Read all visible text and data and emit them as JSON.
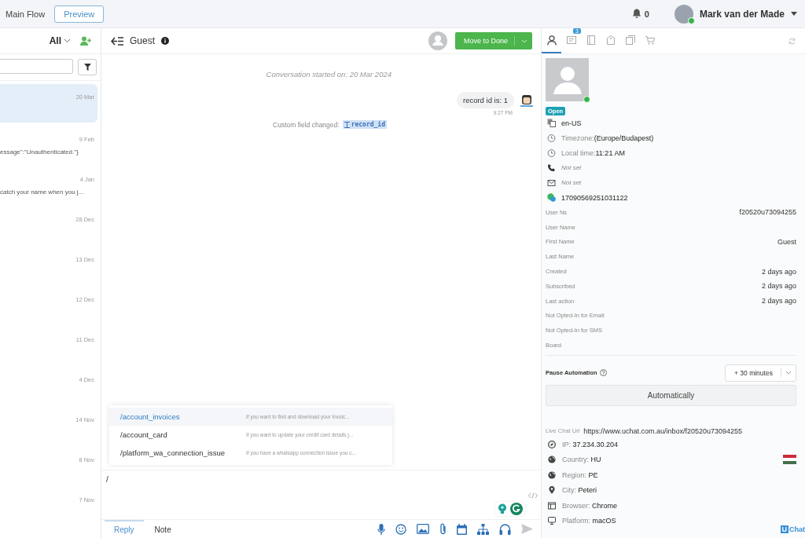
{
  "topbar": {
    "flow_name": "Main Flow",
    "preview_button": "Preview",
    "notifications": "0",
    "user_name": "Mark van der Made",
    "user_online": true
  },
  "conversation_list": {
    "filter": "All",
    "items": [
      {
        "date": "20 Mar",
        "selected": true
      },
      {
        "date": "9 Feb",
        "preview": "essage\":\"Unauthenticated.\"}",
        "selected": false
      },
      {
        "date": "4 Jan",
        "preview": "catch your name when you j...",
        "selected": false
      },
      {
        "date": "28 Dec",
        "selected": false
      },
      {
        "date": "13 Dec",
        "selected": false
      },
      {
        "date": "12 Dec",
        "selected": false
      },
      {
        "date": "11 Dec",
        "selected": false
      },
      {
        "date": "4 Dec",
        "selected": false
      },
      {
        "date": "14 Nov",
        "selected": false
      },
      {
        "date": "8 Nov",
        "selected": false
      },
      {
        "date": "7 Nov",
        "selected": false
      }
    ]
  },
  "chat": {
    "contact_name": "Guest",
    "done_button": "Move to Done",
    "started": "Conversation started on: 20 Mar 2024",
    "messages": [
      {
        "kind": "outgoing",
        "text": "record id is: 1",
        "time": "9:27 PM"
      },
      {
        "kind": "event",
        "text": "Custom field changed:",
        "field": "record_id"
      }
    ],
    "suggestions": [
      {
        "command": "/account_invoices",
        "description": "If you want to find and download your invoic...",
        "selected": true
      },
      {
        "command": "/account_card",
        "description": "If you want to update your credit card details j...",
        "selected": false
      },
      {
        "command": "/platform_wa_connection_issue",
        "description": "If you have a whatsapp connection issue you c...",
        "selected": false
      }
    ],
    "composer_value": "/",
    "tabs": [
      {
        "label": "Reply",
        "selected": true
      },
      {
        "label": "Note",
        "selected": false
      }
    ]
  },
  "profile": {
    "tabs": [
      {
        "kind": "person",
        "selected": true
      },
      {
        "kind": "card",
        "badge": "3",
        "selected": false
      },
      {
        "kind": "book",
        "selected": false
      },
      {
        "kind": "tag",
        "selected": false
      },
      {
        "kind": "copy",
        "selected": false
      },
      {
        "kind": "cart",
        "selected": false
      }
    ],
    "online": true,
    "status": "Open",
    "info": [
      {
        "kind": "locale",
        "value": "en-US",
        "missing": false
      },
      {
        "kind": "clock",
        "label": "Timezone:",
        "value": "(Europe/Budapest)",
        "missing": false
      },
      {
        "kind": "clock",
        "label": "Local time:",
        "value": "11:21 AM",
        "missing": false
      },
      {
        "kind": "phone",
        "value": "Not set",
        "missing": true
      },
      {
        "kind": "email",
        "value": "Not set",
        "missing": true
      },
      {
        "kind": "whatsapp",
        "value": "17090569251031122",
        "missing": false
      }
    ],
    "fields": [
      {
        "label": "User Ns",
        "value": "f20520u73094255"
      },
      {
        "label": "User Name"
      },
      {
        "label": "First Name",
        "value": "Guest"
      },
      {
        "label": "Last Name"
      },
      {
        "label": "Created",
        "value": "2 days ago"
      },
      {
        "label": "Subscribed",
        "value": "2 days ago"
      },
      {
        "label": "Last action",
        "value": "2 days ago"
      },
      {
        "label": "Not Opted-In for Email"
      },
      {
        "label": "Not Opted-In for SMS"
      },
      {
        "label": "Board"
      }
    ],
    "pause_automation": {
      "label": "Pause Automation",
      "duration": "+ 30 minutes",
      "button": "Automatically"
    },
    "live_chat_url": {
      "label": "Live Chat Url",
      "value": "https://www.uchat.com.au/inbox/f20520u73094255"
    },
    "geo": [
      {
        "kind": "ip",
        "label": "IP:",
        "value": "37.234.30.204"
      },
      {
        "kind": "country",
        "label": "Country:",
        "value": "HU"
      },
      {
        "kind": "region",
        "label": "Region:",
        "value": "PE"
      },
      {
        "kind": "city",
        "label": "City:",
        "value": "Peteri"
      },
      {
        "kind": "browser",
        "label": "Browser:",
        "value": "Chrome"
      },
      {
        "kind": "platform",
        "label": "Platform:",
        "value": "macOS"
      }
    ]
  },
  "brand": {
    "mark": "U",
    "text": "Chat"
  }
}
